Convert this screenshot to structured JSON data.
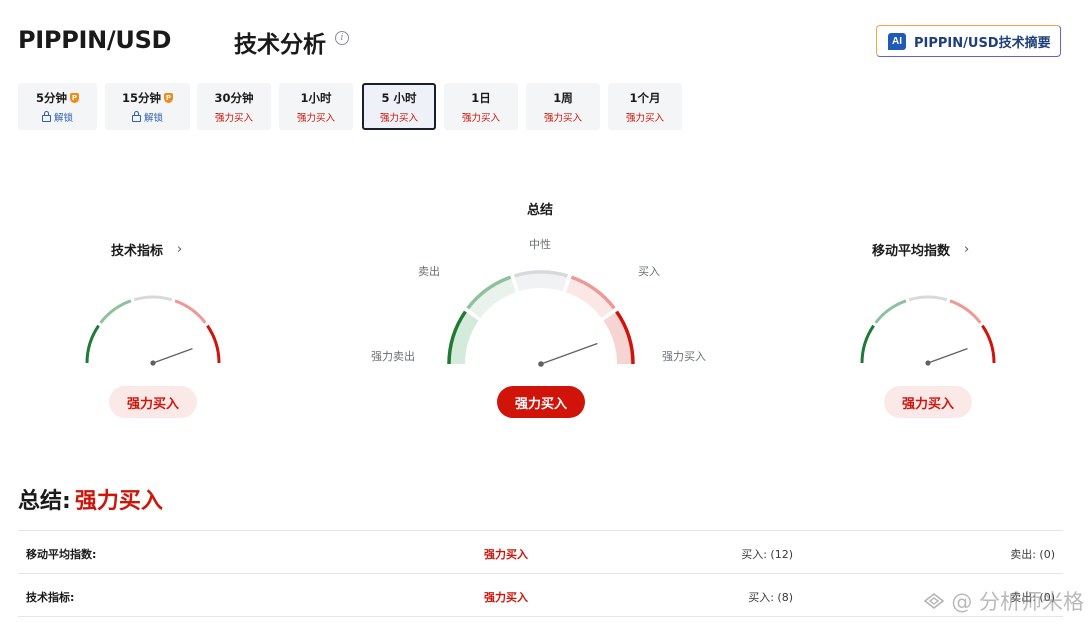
{
  "header": {
    "symbol": "PIPPIN/USD",
    "title": "技术分析",
    "info_icon": "i",
    "ai_badge": "AI",
    "ai_button_label": "PIPPIN/USD技术摘要"
  },
  "tabs": [
    {
      "label": "5分钟",
      "sub": "解锁",
      "locked": true,
      "pro": true
    },
    {
      "label": "15分钟",
      "sub": "解锁",
      "locked": true,
      "pro": true
    },
    {
      "label": "30分钟",
      "sub": "强力买入"
    },
    {
      "label": "1小时",
      "sub": "强力买入"
    },
    {
      "label": "5 小时",
      "sub": "强力买入",
      "active": true
    },
    {
      "label": "1日",
      "sub": "强力买入"
    },
    {
      "label": "1周",
      "sub": "强力买入"
    },
    {
      "label": "1个月",
      "sub": "强力买入"
    }
  ],
  "pro_badge": "P",
  "gauges": {
    "indicators": {
      "title": "技术指标",
      "chevron": "›",
      "verdict": "强力买入",
      "needle_level": "strong_buy"
    },
    "summary": {
      "title": "总结",
      "verdict": "强力买入",
      "needle_level": "strong_buy",
      "zones": {
        "neutral": "中性",
        "sell": "卖出",
        "buy": "买入",
        "strong_sell": "强力卖出",
        "strong_buy": "强力买入"
      }
    },
    "moving_averages": {
      "title": "移动平均指数",
      "chevron": "›",
      "verdict": "强力买入",
      "needle_level": "strong_buy"
    }
  },
  "summary": {
    "label": "总结:",
    "verdict": "强力买入",
    "rows": [
      {
        "name": "移动平均指数:",
        "verdict": "强力买入",
        "buy": "买入: (12)",
        "sell": "卖出: (0)"
      },
      {
        "name": "技术指标:",
        "verdict": "强力买入",
        "buy": "买入: (8)",
        "sell": "卖出: (0)"
      }
    ]
  },
  "watermark": "@ 分析师米格",
  "colors": {
    "strong_sell": "#1e7a35",
    "sell": "#8fc29c",
    "neutral": "#d7d9dc",
    "buy": "#ec9a96",
    "strong_buy": "#d0140a"
  }
}
